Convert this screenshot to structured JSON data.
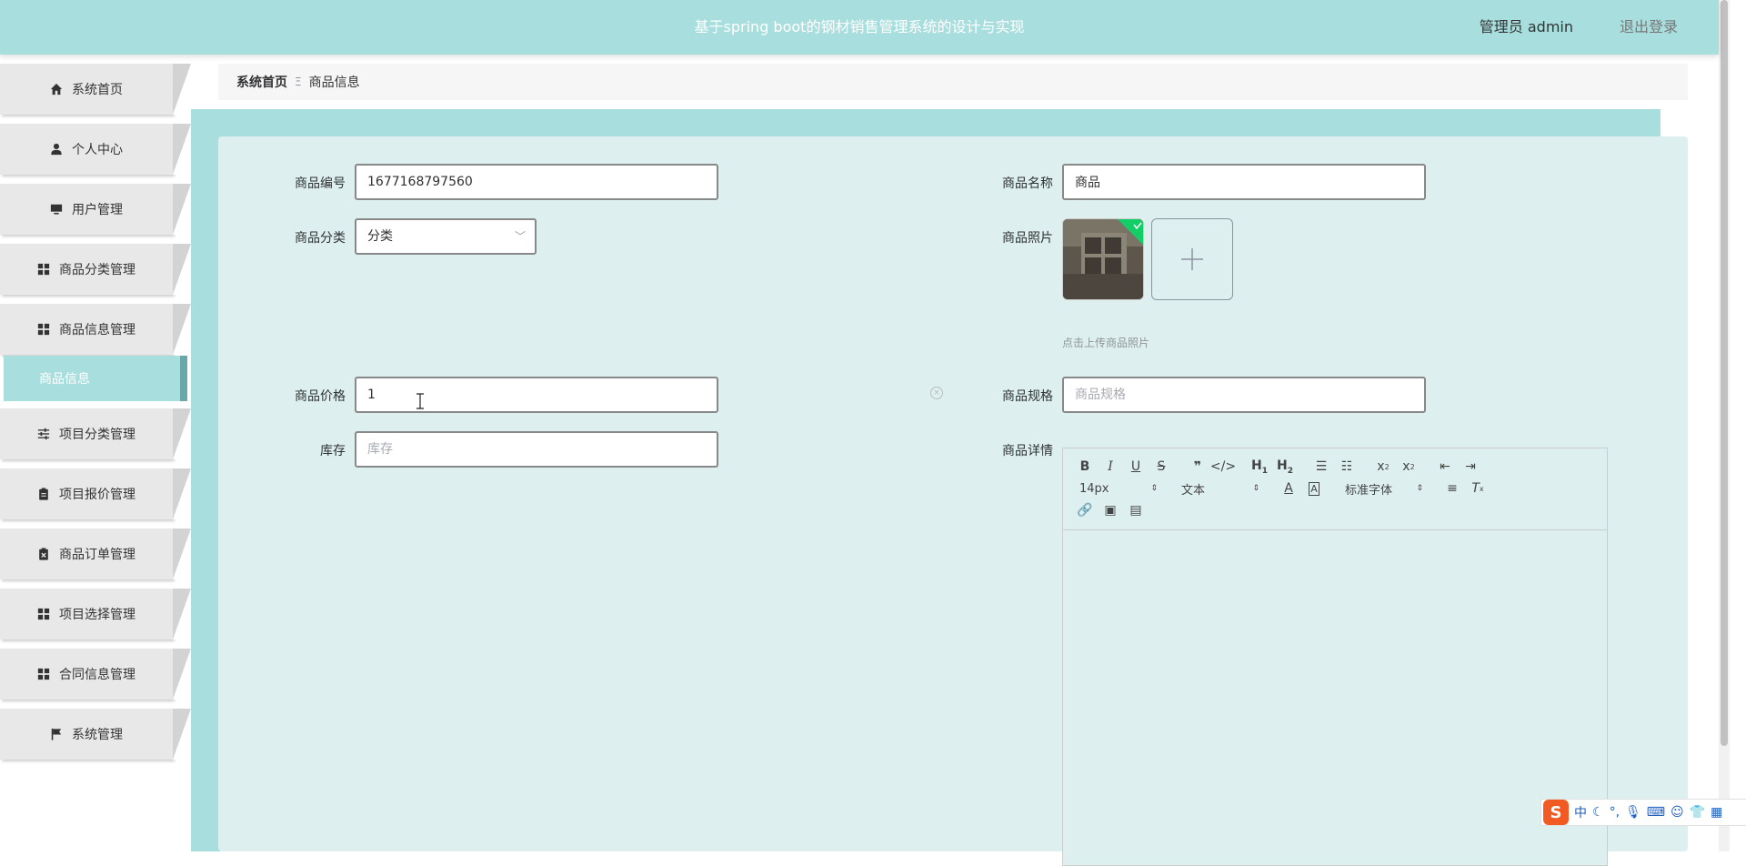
{
  "header": {
    "title": "基于spring boot的钢材销售管理系统的设计与实现",
    "user": "管理员 admin",
    "logout": "退出登录"
  },
  "sidebar": {
    "items": [
      {
        "label": "系统首页",
        "icon": "home-icon"
      },
      {
        "label": "个人中心",
        "icon": "person-icon"
      },
      {
        "label": "用户管理",
        "icon": "monitor-icon"
      },
      {
        "label": "商品分类管理",
        "icon": "grid-icon"
      },
      {
        "label": "商品信息管理",
        "icon": "grid-icon"
      },
      {
        "label": "项目分类管理",
        "icon": "sliders-icon"
      },
      {
        "label": "项目报价管理",
        "icon": "clipboard-icon"
      },
      {
        "label": "商品订单管理",
        "icon": "clipboard-x-icon"
      },
      {
        "label": "项目选择管理",
        "icon": "grid-icon"
      },
      {
        "label": "合同信息管理",
        "icon": "grid-icon"
      },
      {
        "label": "系统管理",
        "icon": "flag-icon"
      }
    ],
    "active_sub": "商品信息"
  },
  "breadcrumb": {
    "home": "系统首页",
    "separator": "Ξ",
    "current": "商品信息"
  },
  "form": {
    "code_label": "商品编号",
    "code_value": "1677168797560",
    "name_label": "商品名称",
    "name_value": "商品",
    "category_label": "商品分类",
    "category_value": "分类",
    "photo_label": "商品照片",
    "photo_hint": "点击上传商品照片",
    "price_label": "商品价格",
    "price_value": "1",
    "spec_label": "商品规格",
    "spec_placeholder": "商品规格",
    "stock_label": "库存",
    "stock_placeholder": "库存",
    "detail_label": "商品详情"
  },
  "editor": {
    "font_size": "14px",
    "block_type": "文本",
    "font_family": "标准字体"
  },
  "ime": {
    "mode": "中"
  },
  "colors": {
    "header_bg": "#a8dedd",
    "card_bg": "#ddf0ef",
    "active_border": "#6aa7a8"
  }
}
